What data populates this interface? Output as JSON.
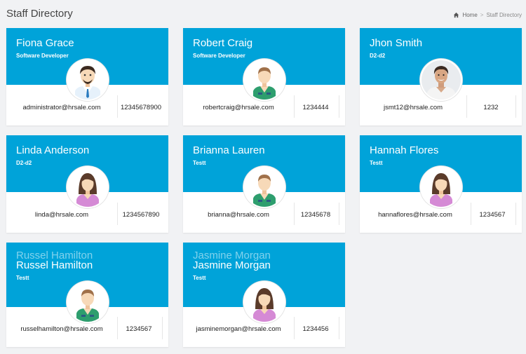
{
  "header": {
    "title": "Staff Directory",
    "breadcrumb": [
      "Home",
      "Staff Directory"
    ]
  },
  "colors": {
    "card_header": "#00a3d9",
    "background": "#f1f2f4"
  },
  "staff": [
    {
      "name": "Fiona Grace",
      "role": "Software Developer",
      "email": "administrator@hrsale.com",
      "phone": "12345678900",
      "avatar": "businessman-avatar-icon"
    },
    {
      "name": "Robert Craig",
      "role": "Software Developer",
      "email": "robertcraig@hrsale.com",
      "phone": "1234444",
      "avatar": "male-avatar-icon"
    },
    {
      "name": "Jhon Smith",
      "role": "D2-d2",
      "email": "jsmt12@hrsale.com",
      "phone": "1232",
      "avatar": "photo-avatar-icon"
    },
    {
      "name": "Linda Anderson",
      "role": "D2-d2",
      "email": "linda@hrsale.com",
      "phone": "1234567890",
      "avatar": "female-avatar-icon"
    },
    {
      "name": "Brianna Lauren",
      "role": "Testt",
      "email": "brianna@hrsale.com",
      "phone": "12345678",
      "avatar": "male-avatar-icon"
    },
    {
      "name": "Hannah Flores",
      "role": "Testt",
      "email": "hannaflores@hrsale.com",
      "phone": "1234567",
      "avatar": "female-avatar-icon"
    },
    {
      "name": "Russel Hamilton",
      "role": "Testt",
      "email": "russelhamilton@hrsale.com",
      "phone": "1234567",
      "avatar": "male-avatar-icon"
    },
    {
      "name": "Jasmine Morgan",
      "role": "Testt",
      "email": "jasminemorgan@hrsale.com",
      "phone": "1234456",
      "avatar": "female-avatar-icon"
    }
  ]
}
